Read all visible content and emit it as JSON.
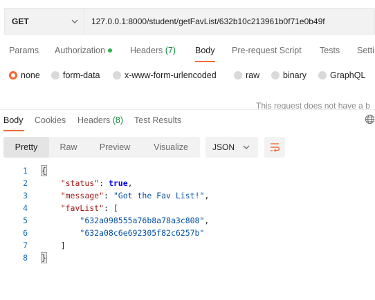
{
  "request": {
    "method": "GET",
    "url": "127.0.0.1:8000/student/getFavList/632b10c213961b0f71e0b49f"
  },
  "request_tabs": [
    {
      "label": "Params"
    },
    {
      "label": "Authorization"
    },
    {
      "label": "Headers",
      "count": "(7)"
    },
    {
      "label": "Body",
      "active": true
    },
    {
      "label": "Pre-request Script"
    },
    {
      "label": "Tests"
    },
    {
      "label": "Setti"
    }
  ],
  "body_types": [
    "none",
    "form-data",
    "x-www-form-urlencoded",
    "raw",
    "binary",
    "GraphQL"
  ],
  "selected_body_type": "none",
  "notice": "This request does not have a b",
  "response_tabs": [
    {
      "label": "Body",
      "active": true
    },
    {
      "label": "Cookies"
    },
    {
      "label": "Headers",
      "count": "(8)"
    },
    {
      "label": "Test Results"
    }
  ],
  "view_modes": [
    "Pretty",
    "Raw",
    "Preview",
    "Visualize"
  ],
  "active_view": "Pretty",
  "format": "JSON",
  "response_lines": [
    {
      "n": "1",
      "parts": [
        {
          "t": "{",
          "c": "punc brace-box"
        }
      ]
    },
    {
      "n": "2",
      "parts": [
        {
          "t": "    "
        },
        {
          "t": "\"status\"",
          "c": "key"
        },
        {
          "t": ": ",
          "c": "punc"
        },
        {
          "t": "true",
          "c": "bool"
        },
        {
          "t": ",",
          "c": "punc"
        }
      ]
    },
    {
      "n": "3",
      "parts": [
        {
          "t": "    "
        },
        {
          "t": "\"message\"",
          "c": "key"
        },
        {
          "t": ": ",
          "c": "punc"
        },
        {
          "t": "\"Got the Fav List!\"",
          "c": "str"
        },
        {
          "t": ",",
          "c": "punc"
        }
      ]
    },
    {
      "n": "4",
      "parts": [
        {
          "t": "    "
        },
        {
          "t": "\"favList\"",
          "c": "key"
        },
        {
          "t": ": [",
          "c": "punc"
        }
      ]
    },
    {
      "n": "5",
      "parts": [
        {
          "t": "        "
        },
        {
          "t": "\"632a098555a76b8a78a3c808\"",
          "c": "str"
        },
        {
          "t": ",",
          "c": "punc"
        }
      ]
    },
    {
      "n": "6",
      "parts": [
        {
          "t": "        "
        },
        {
          "t": "\"632a08c6e692305f82c6257b\"",
          "c": "str"
        }
      ]
    },
    {
      "n": "7",
      "parts": [
        {
          "t": "    "
        },
        {
          "t": "]",
          "c": "punc"
        }
      ]
    },
    {
      "n": "8",
      "parts": [
        {
          "t": "}",
          "c": "punc brace-box"
        }
      ]
    }
  ],
  "colors": {
    "accent": "#f26b3a",
    "status_dot": "#2bb24c",
    "count": "#0a8a3a",
    "line_number": "#1a6fb3",
    "json_key": "#a31515",
    "json_string": "#0451a5",
    "json_bool": "#0000ff"
  },
  "icons": {
    "method_dropdown": "chevron-down-icon",
    "format_dropdown": "chevron-down-icon",
    "wrap": "wrap-lines-icon",
    "globe": "globe-icon"
  }
}
